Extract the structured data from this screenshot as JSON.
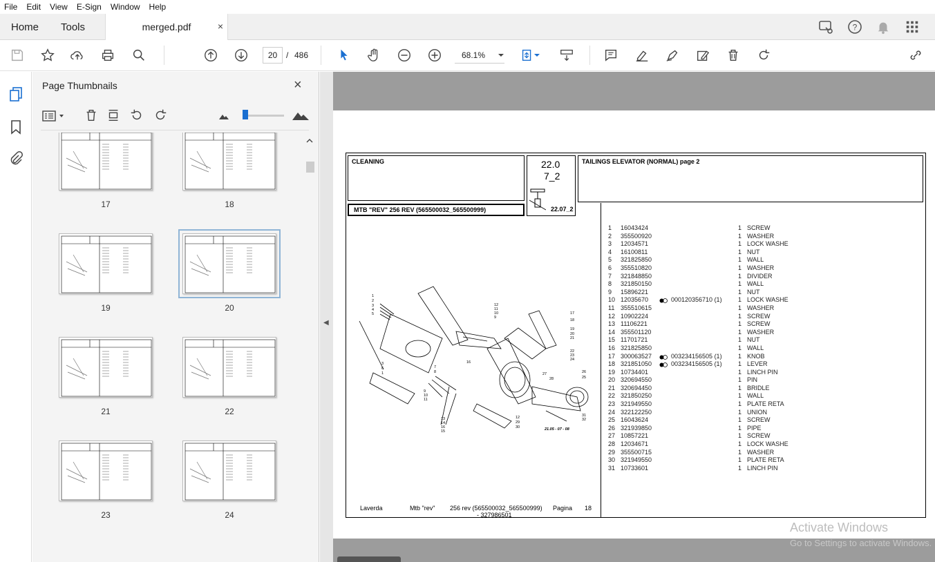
{
  "menu": [
    "File",
    "Edit",
    "View",
    "E-Sign",
    "Window",
    "Help"
  ],
  "tabs": {
    "home": "Home",
    "tools": "Tools",
    "doc": "merged.pdf",
    "close": "×"
  },
  "toolbar": {
    "page_current": "20",
    "page_sep": "/",
    "page_total": "486",
    "zoom": "68.1%"
  },
  "panel": {
    "title": "Page Thumbnails",
    "close": "×"
  },
  "thumbnails": [
    "17",
    "18",
    "19",
    "20",
    "21",
    "22",
    "23",
    "24"
  ],
  "doc": {
    "section": "CLEANING",
    "code1": "22.0",
    "code2": "7_2",
    "ref": "22.07_2",
    "title": "TAILINGS ELEVATOR (NORMAL)  page 2",
    "model": "MTB \"REV\" 256 REV (565500032_565500999)",
    "footer_brand": "Laverda",
    "footer_model": "Mtb \"rev\"",
    "footer_rev": "256 rev (565500032_565500999)",
    "footer_num": "- 327986501",
    "footer_page_label": "Pagina",
    "footer_page": "18",
    "diagram_code": "21.05 - 07 - 08"
  },
  "parts": [
    {
      "n": "1",
      "code": "16043424",
      "note": "",
      "q": "1",
      "desc": "SCREW"
    },
    {
      "n": "2",
      "code": "355500920",
      "note": "",
      "q": "1",
      "desc": "WASHER"
    },
    {
      "n": "3",
      "code": "12034571",
      "note": "",
      "q": "1",
      "desc": "LOCK WASHE"
    },
    {
      "n": "4",
      "code": "16100811",
      "note": "",
      "q": "1",
      "desc": "NUT"
    },
    {
      "n": "5",
      "code": "321825850",
      "note": "",
      "q": "1",
      "desc": "WALL"
    },
    {
      "n": "6",
      "code": "355510820",
      "note": "",
      "q": "1",
      "desc": "WASHER"
    },
    {
      "n": "7",
      "code": "321848850",
      "note": "",
      "q": "1",
      "desc": "DIVIDER"
    },
    {
      "n": "8",
      "code": "321850150",
      "note": "",
      "q": "1",
      "desc": "WALL"
    },
    {
      "n": "9",
      "code": "15896221",
      "note": "",
      "q": "1",
      "desc": "NUT"
    },
    {
      "n": "10",
      "code": "12035670",
      "note": "000120356710  (1)",
      "q": "1",
      "desc": "LOCK WASHE"
    },
    {
      "n": "11",
      "code": "355510615",
      "note": "",
      "q": "1",
      "desc": "WASHER"
    },
    {
      "n": "12",
      "code": "10902224",
      "note": "",
      "q": "1",
      "desc": "SCREW"
    },
    {
      "n": "13",
      "code": "11106221",
      "note": "",
      "q": "1",
      "desc": "SCREW"
    },
    {
      "n": "14",
      "code": "355501120",
      "note": "",
      "q": "1",
      "desc": "WASHER"
    },
    {
      "n": "15",
      "code": "11701721",
      "note": "",
      "q": "1",
      "desc": "NUT"
    },
    {
      "n": "16",
      "code": "321825850",
      "note": "",
      "q": "1",
      "desc": "WALL"
    },
    {
      "n": "17",
      "code": "300063527",
      "note": "003234156505  (1)",
      "q": "1",
      "desc": "KNOB"
    },
    {
      "n": "18",
      "code": "321851050",
      "note": "003234156505  (1)",
      "q": "1",
      "desc": "LEVER"
    },
    {
      "n": "19",
      "code": "10734401",
      "note": "",
      "q": "1",
      "desc": "LINCH PIN"
    },
    {
      "n": "20",
      "code": "320694550",
      "note": "",
      "q": "1",
      "desc": "PIN"
    },
    {
      "n": "21",
      "code": "320694450",
      "note": "",
      "q": "1",
      "desc": "BRIDLE"
    },
    {
      "n": "22",
      "code": "321850250",
      "note": "",
      "q": "1",
      "desc": "WALL"
    },
    {
      "n": "23",
      "code": "321949550",
      "note": "",
      "q": "1",
      "desc": "PLATE RETA"
    },
    {
      "n": "24",
      "code": "322122250",
      "note": "",
      "q": "1",
      "desc": "UNION"
    },
    {
      "n": "25",
      "code": "16043624",
      "note": "",
      "q": "1",
      "desc": "SCREW"
    },
    {
      "n": "26",
      "code": "321939850",
      "note": "",
      "q": "1",
      "desc": "PIPE"
    },
    {
      "n": "27",
      "code": "10857221",
      "note": "",
      "q": "1",
      "desc": "SCREW"
    },
    {
      "n": "28",
      "code": "12034671",
      "note": "",
      "q": "1",
      "desc": "LOCK WASHE"
    },
    {
      "n": "29",
      "code": "355500715",
      "note": "",
      "q": "1",
      "desc": "WASHER"
    },
    {
      "n": "30",
      "code": "321949550",
      "note": "",
      "q": "1",
      "desc": "PLATE RETA"
    },
    {
      "n": "31",
      "code": "10733601",
      "note": "",
      "q": "1",
      "desc": "LINCH PIN"
    }
  ],
  "watermark": {
    "line1": "Activate Windows",
    "line2": "Go to Settings to activate Windows."
  }
}
